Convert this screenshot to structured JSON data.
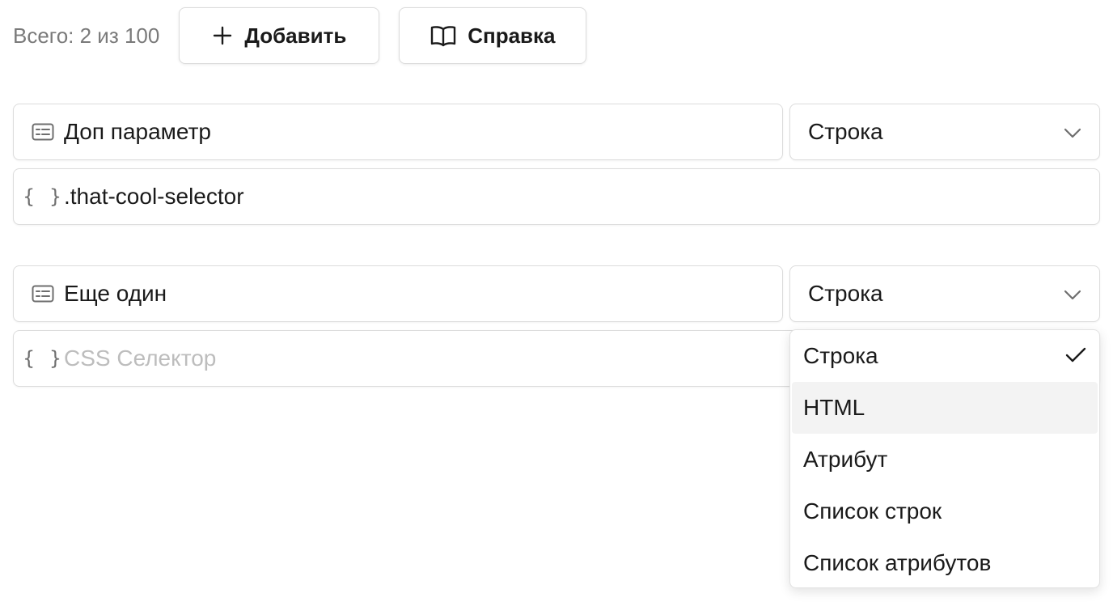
{
  "toolbar": {
    "total_label": "Всего: 2 из 100",
    "add_label": "Добавить",
    "help_label": "Справка"
  },
  "params": [
    {
      "name": "Доп параметр",
      "type": "Строка",
      "selector": ".that-cool-selector",
      "selector_placeholder": "CSS Селектор"
    },
    {
      "name": "Еще один",
      "type": "Строка",
      "selector": "",
      "selector_placeholder": "CSS Селектор"
    }
  ],
  "dropdown": {
    "options": [
      "Строка",
      "HTML",
      "Атрибут",
      "Список строк",
      "Список атрибутов"
    ],
    "selected": "Строка",
    "hovered": "HTML"
  },
  "icons": {
    "add": "plus-icon",
    "help": "book-icon",
    "name": "card-text-icon",
    "selector": "braces-icon",
    "select": "chevron-down-icon",
    "selected": "check-icon"
  },
  "colors": {
    "border": "#dcdcdc",
    "muted_text": "#7a7a7a",
    "placeholder": "#bdbdbd",
    "hover_bg": "#f3f3f3"
  }
}
